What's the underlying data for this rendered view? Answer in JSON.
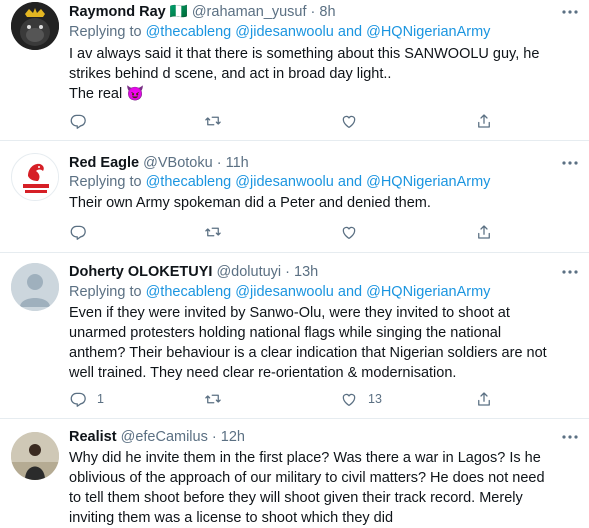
{
  "replying_prefix": "Replying to",
  "replying_and": "and",
  "tweets": [
    {
      "name": "Raymond Ray",
      "flag": "🇳🇬",
      "handle": "@rahaman_yusuf",
      "dot": "·",
      "time": "8h",
      "mentions": [
        "@thecableng",
        "@jidesanwoolu",
        "@HQNigerianArmy"
      ],
      "lines": [
        "I av always said it that there is something about this SANWOOLU guy, he",
        "strikes behind d scene, and act in broad day light..",
        "The real"
      ],
      "emoji": "😈",
      "reply_count": "",
      "like_count": ""
    },
    {
      "name": "Red Eagle",
      "handle": "@VBotoku",
      "dot": "·",
      "time": "11h",
      "avatar_label": "RED EAGLE",
      "mentions": [
        "@thecableng",
        "@jidesanwoolu",
        "@HQNigerianArmy"
      ],
      "lines": [
        "Their own Army spokeman did a Peter and denied them."
      ],
      "reply_count": "",
      "like_count": ""
    },
    {
      "name": "Doherty OLOKETUYI",
      "handle": "@dolutuyi",
      "dot": "·",
      "time": "13h",
      "mentions": [
        "@thecableng",
        "@jidesanwoolu",
        "@HQNigerianArmy"
      ],
      "lines": [
        "Even if they were invited by Sanwo-Olu, were they invited to shoot at",
        "unarmed protesters holding national flags while singing the national",
        "anthem? Their behaviour is a clear indication that Nigerian soldiers are not",
        "well trained. They need clear re-orientation & modernisation."
      ],
      "reply_count": "1",
      "like_count": "13"
    },
    {
      "name": "Realist",
      "handle": "@efeCamilus",
      "dot": "·",
      "time": "12h",
      "lines": [
        "Why did he invite them in the first place? Was there a war in Lagos? Is he",
        "oblivious of the approach of our military to civil matters? He does not need",
        "to tell them shoot before they will shoot given their track record. Merely",
        "inviting them was a license to shoot which they did"
      ]
    }
  ],
  "colors": {
    "text": "#0f1419",
    "muted": "#5b7083",
    "link": "#1b95e0",
    "divider": "#e6ecf0"
  },
  "icons": [
    "more-icon",
    "reply-icon",
    "retweet-icon",
    "like-icon",
    "share-icon",
    "devil-emoji",
    "nigeria-flag"
  ]
}
